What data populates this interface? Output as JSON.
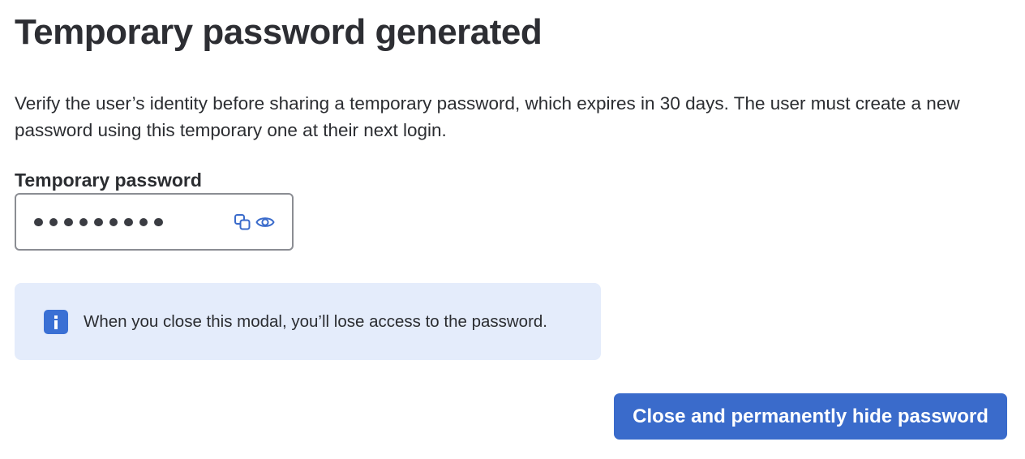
{
  "modal": {
    "title": "Temporary password generated",
    "description": "Verify the user’s identity before sharing a temporary password, which expires in 30 days. The user must create a new password using this temporary one at their next login.",
    "field_label": "Temporary password",
    "password_field": {
      "masked_value": "●●●●●●●●●",
      "mask_length": 9,
      "copy_icon": "copy-icon",
      "reveal_icon": "eye-icon"
    },
    "notice": {
      "icon": "info-icon",
      "text": "When you close this modal, you’ll lose access to the password."
    },
    "primary_button_label": "Close and permanently hide password"
  },
  "colors": {
    "text": "#2b2d31",
    "accent": "#3a6bcb",
    "notice_background": "#e4ecfb",
    "info_icon": "#3a70d4",
    "field_border": "#8b8d93"
  }
}
